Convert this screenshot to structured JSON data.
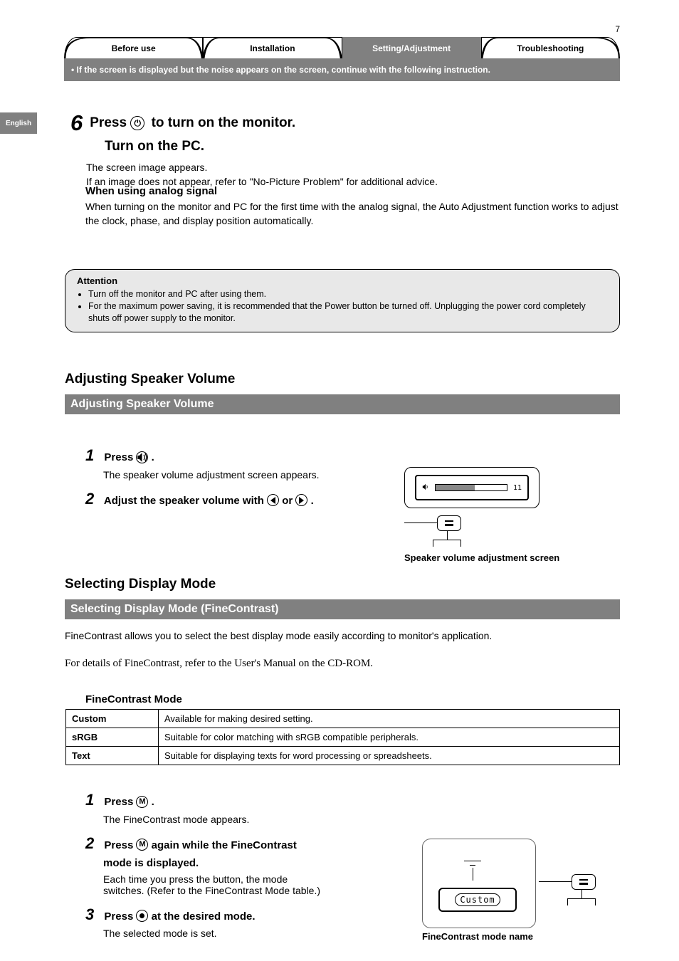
{
  "page_number": "7",
  "lang_tab": "English",
  "tabs": {
    "t1": "Before use",
    "t2": "Installation",
    "t3": "Setting/Adjustment",
    "t4": "Troubleshooting"
  },
  "header_note": "• If the screen is displayed but the noise appears on the screen, continue with the following instruction.",
  "step6": {
    "num": "6",
    "pre": "Press ",
    "post": " to turn on the monitor."
  },
  "substep": "Turn on the PC.",
  "screen_image_appears": "The screen image appears.",
  "no_image": "If an image does not appear, refer to \"No-Picture Problem\" for additional advice.",
  "analog": {
    "head": "When using analog signal",
    "body": "When turning on the monitor and PC for the first time with the analog signal, the Auto Adjustment function works to adjust the clock, phase, and display position automatically."
  },
  "note": {
    "title": "Attention",
    "items": [
      "Turn off the monitor and PC after using them.",
      "For the maximum power saving, it is recommended that the Power button be turned off. Unplugging the power cord completely shuts off power supply to the monitor."
    ]
  },
  "sec1_title": "Adjusting Speaker Volume",
  "sec1_bar": "Adjusting Speaker Volume",
  "speaker": {
    "s1_num": "1",
    "s1_line": "Press ",
    "s1_line_post": ".",
    "s1_body": "The speaker volume adjustment screen appears.",
    "s2_num": "2",
    "s2_line_pre": "Adjust the speaker volume with ",
    "s2_line_mid": " or ",
    "s2_line_post": "."
  },
  "osd_vol": {
    "value": "11",
    "label": "Speaker volume adjustment screen"
  },
  "sec2_title": "Selecting Display Mode",
  "sec2_bar": "Selecting Display Mode (FineContrast)",
  "sec2_intro": "FineContrast allows you to select the best display mode easily according to monitor's application.",
  "sec2_intro2": "For details of FineContrast, refer to the User's Manual on the CD-ROM.",
  "mode_table_title": "FineContrast Mode",
  "modes": {
    "r1c1": "Custom",
    "r1c2": "Available for making desired setting.",
    "r2c1": "sRGB",
    "r2c2": "Suitable for color matching with sRGB compatible peripherals.",
    "r3c1": "Text",
    "r3c2": "Suitable for displaying texts for word processing or spreadsheets."
  },
  "fc": {
    "s1_num": "1",
    "s1_pre": "Press ",
    "s1_post": ".",
    "s1_body": "The FineContrast mode appears.",
    "s2_num": "2",
    "s2_pre": "Press ",
    "s2_mid": " again while the FineContrast",
    "s2_line2": "mode is displayed.",
    "s2_body_pre": "Each time you press the button, the mode",
    "s2_body2": "switches. (Refer to the FineContrast Mode table.)",
    "s3_num": "3",
    "s3_pre": "Press ",
    "s3_post": " at the desired mode.",
    "s3_body": "The selected mode is set."
  },
  "osd_fc": {
    "mode": "Custom",
    "label": "FineContrast mode name"
  }
}
